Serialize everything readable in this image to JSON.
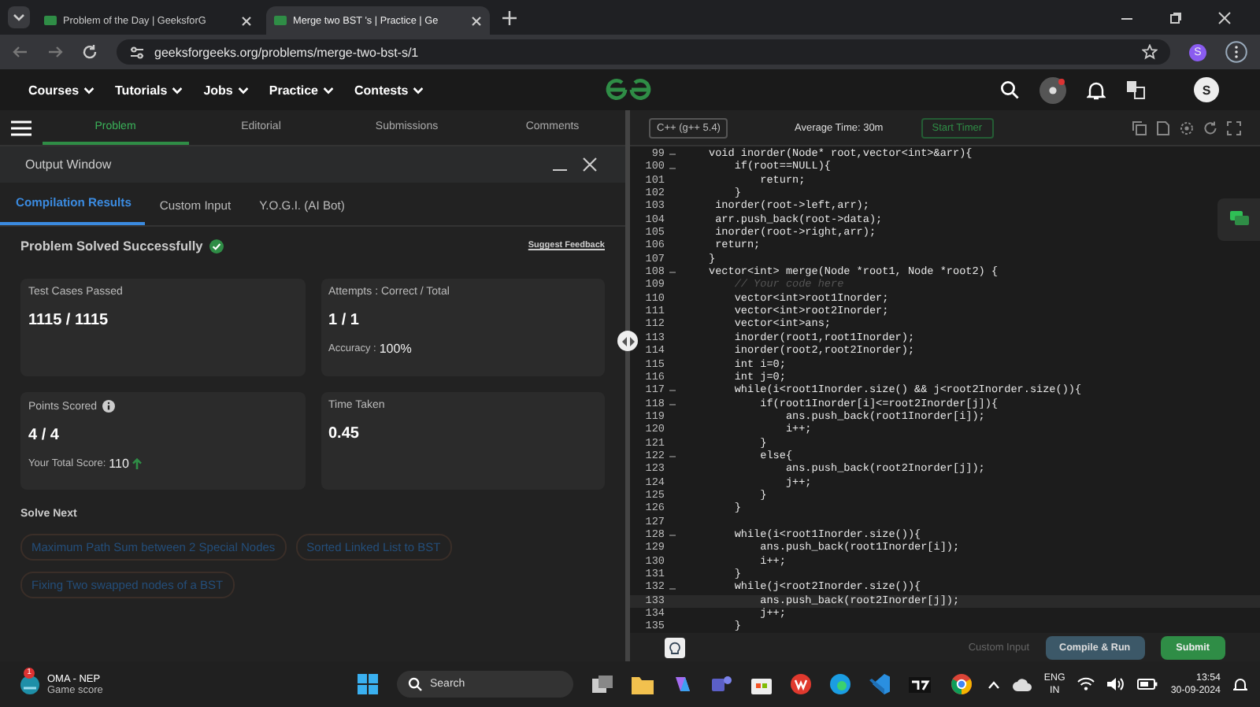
{
  "browser": {
    "tabs": [
      {
        "title": "Problem of the Day | GeeksforG",
        "selected": false
      },
      {
        "title": "Merge two BST 's | Practice | Ge",
        "selected": true
      }
    ],
    "url": "geeksforgeeks.org/problems/merge-two-bst-s/1",
    "profile": "S"
  },
  "site_nav": {
    "items": [
      "Courses",
      "Tutorials",
      "Jobs",
      "Practice",
      "Contests"
    ],
    "avatar": "S"
  },
  "problem_tabs": [
    {
      "label": "Problem",
      "selected": true
    },
    {
      "label": "Editorial",
      "selected": false
    },
    {
      "label": "Submissions",
      "selected": false
    },
    {
      "label": "Comments",
      "selected": false
    }
  ],
  "output_window": {
    "title": "Output Window",
    "tabs": [
      {
        "label": "Compilation Results",
        "selected": true
      },
      {
        "label": "Custom Input",
        "selected": false
      },
      {
        "label": "Y.O.G.I. (AI Bot)",
        "selected": false
      }
    ],
    "status": "Problem Solved Successfully",
    "feedback_link": "Suggest Feedback",
    "cards": [
      {
        "label": "Test Cases Passed",
        "value": "1115 / 1115"
      },
      {
        "label": "Attempts : Correct / Total",
        "value": "1 / 1",
        "note_label": "Accuracy :",
        "note_value": "100%"
      },
      {
        "label": "Points Scored",
        "value": "4 / 4",
        "info": true,
        "note_label": "Your Total Score:",
        "note_value": "110"
      },
      {
        "label": "Time Taken",
        "value": "0.45"
      }
    ],
    "solve_next_title": "Solve Next",
    "solve_next": [
      "Maximum Path Sum between 2 Special Nodes",
      "Sorted Linked List to BST",
      "Fixing Two swapped nodes of a BST"
    ]
  },
  "editor": {
    "language": "C++ (g++ 5.4)",
    "average_time": "Average Time: 30m",
    "timer_button": "Start Timer",
    "lines": [
      {
        "number": "99",
        "code": "void inorder(Node* root,vector<int>&arr){",
        "foldable": true,
        "current": false
      },
      {
        "number": "100",
        "code": "    if(root==NULL){",
        "foldable": true,
        "current": false
      },
      {
        "number": "101",
        "code": "        return;",
        "foldable": false,
        "current": false
      },
      {
        "number": "102",
        "code": "    }",
        "foldable": false,
        "current": false
      },
      {
        "number": "103",
        "code": " inorder(root->left,arr);",
        "foldable": false,
        "current": false
      },
      {
        "number": "104",
        "code": " arr.push_back(root->data);",
        "foldable": false,
        "current": false
      },
      {
        "number": "105",
        "code": " inorder(root->right,arr);",
        "foldable": false,
        "current": false
      },
      {
        "number": "106",
        "code": " return;",
        "foldable": false,
        "current": false
      },
      {
        "number": "107",
        "code": "}",
        "foldable": false,
        "current": false
      },
      {
        "number": "108",
        "code": "vector<int> merge(Node *root1, Node *root2) {",
        "foldable": true,
        "current": false
      },
      {
        "number": "109",
        "code": "    // Your code here",
        "kind": "comment",
        "foldable": false,
        "current": false
      },
      {
        "number": "110",
        "code": "    vector<int>root1Inorder;",
        "foldable": false,
        "current": false
      },
      {
        "number": "111",
        "code": "    vector<int>root2Inorder;",
        "foldable": false,
        "current": false
      },
      {
        "number": "112",
        "code": "    vector<int>ans;",
        "foldable": false,
        "current": false
      },
      {
        "number": "113",
        "code": "    inorder(root1,root1Inorder);",
        "foldable": false,
        "current": false
      },
      {
        "number": "114",
        "code": "    inorder(root2,root2Inorder);",
        "foldable": false,
        "current": false
      },
      {
        "number": "115",
        "code": "    int i=0;",
        "foldable": false,
        "current": false
      },
      {
        "number": "116",
        "code": "    int j=0;",
        "foldable": false,
        "current": false
      },
      {
        "number": "117",
        "code": "    while(i<root1Inorder.size() && j<root2Inorder.size()){",
        "foldable": true,
        "current": false
      },
      {
        "number": "118",
        "code": "        if(root1Inorder[i]<=root2Inorder[j]){",
        "foldable": true,
        "current": false
      },
      {
        "number": "119",
        "code": "            ans.push_back(root1Inorder[i]);",
        "foldable": false,
        "current": false
      },
      {
        "number": "120",
        "code": "            i++;",
        "foldable": false,
        "current": false
      },
      {
        "number": "121",
        "code": "        }",
        "foldable": false,
        "current": false
      },
      {
        "number": "122",
        "code": "        else{",
        "foldable": true,
        "current": false
      },
      {
        "number": "123",
        "code": "            ans.push_back(root2Inorder[j]);",
        "foldable": false,
        "current": false
      },
      {
        "number": "124",
        "code": "            j++;",
        "foldable": false,
        "current": false
      },
      {
        "number": "125",
        "code": "        }",
        "foldable": false,
        "current": false
      },
      {
        "number": "126",
        "code": "    }",
        "foldable": false,
        "current": false
      },
      {
        "number": "127",
        "foldable": false,
        "current": false
      },
      {
        "number": "128",
        "code": "    while(i<root1Inorder.size()){",
        "foldable": true,
        "current": false
      },
      {
        "number": "129",
        "code": "        ans.push_back(root1Inorder[i]);",
        "foldable": false,
        "current": false
      },
      {
        "number": "130",
        "code": "        i++;",
        "foldable": false,
        "current": false
      },
      {
        "number": "131",
        "code": "    }",
        "foldable": false,
        "current": false
      },
      {
        "number": "132",
        "code": "    while(j<root2Inorder.size()){",
        "foldable": true,
        "current": false
      },
      {
        "number": "133",
        "code": "        ans.push_back(root2Inorder[j]);",
        "foldable": false,
        "current": true
      },
      {
        "number": "134",
        "code": "        j++;",
        "foldable": false,
        "current": false
      },
      {
        "number": "135",
        "code": "    }",
        "foldable": false,
        "current": false
      }
    ],
    "buttons": {
      "custom_input": "Custom Input",
      "compile": "Compile & Run",
      "submit": "Submit"
    }
  },
  "taskbar": {
    "widget_title": "OMA - NEP",
    "widget_subtitle": "Game score",
    "widget_badge": "1",
    "search": "Search",
    "lang_top": "ENG",
    "lang_bottom": "IN",
    "time": "13:54",
    "date": "30-09-2024"
  }
}
